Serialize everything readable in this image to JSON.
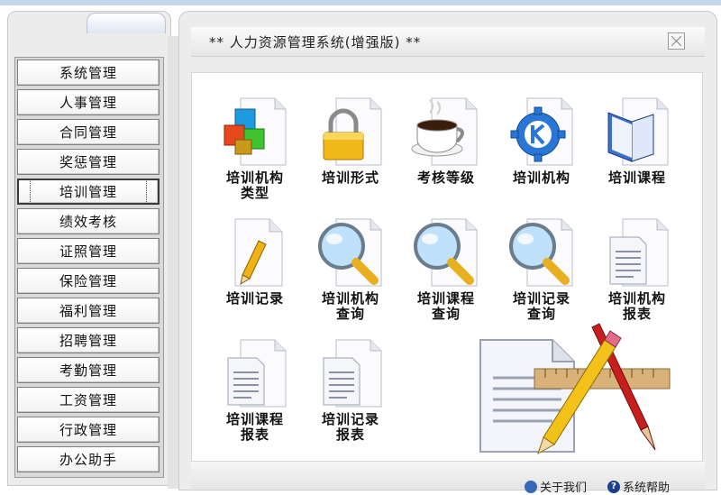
{
  "window": {
    "title": "** 人力资源管理系统(增强版) **"
  },
  "sidebar": {
    "items": [
      {
        "label": "系统管理"
      },
      {
        "label": "人事管理"
      },
      {
        "label": "合同管理"
      },
      {
        "label": "奖惩管理"
      },
      {
        "label": "培训管理",
        "active": true
      },
      {
        "label": "绩效考核"
      },
      {
        "label": "证照管理"
      },
      {
        "label": "保险管理"
      },
      {
        "label": "福利管理"
      },
      {
        "label": "招聘管理"
      },
      {
        "label": "考勤管理"
      },
      {
        "label": "工资管理"
      },
      {
        "label": "行政管理"
      },
      {
        "label": "办公助手"
      }
    ]
  },
  "modules": [
    {
      "line1": "培训机构",
      "line2": "类型",
      "icon": "colored-cubes-icon"
    },
    {
      "line1": "培训形式",
      "line2": "",
      "icon": "padlock-icon"
    },
    {
      "line1": "考核等级",
      "line2": "",
      "icon": "coffee-cup-icon"
    },
    {
      "line1": "培训机构",
      "line2": "",
      "icon": "gear-k-icon"
    },
    {
      "line1": "培训课程",
      "line2": "",
      "icon": "open-book-icon"
    },
    {
      "line1": "培训记录",
      "line2": "",
      "icon": "document-pencil-icon"
    },
    {
      "line1": "培训机构",
      "line2": "查询",
      "icon": "magnifier-icon"
    },
    {
      "line1": "培训课程",
      "line2": "查询",
      "icon": "magnifier-icon"
    },
    {
      "line1": "培训记录",
      "line2": "查询",
      "icon": "magnifier-icon"
    },
    {
      "line1": "培训机构",
      "line2": "报表",
      "icon": "report-document-icon"
    },
    {
      "line1": "培训课程",
      "line2": "报表",
      "icon": "report-document-icon"
    },
    {
      "line1": "培训记录",
      "line2": "报表",
      "icon": "report-document-icon"
    }
  ],
  "footer": {
    "about_label": "关于我们",
    "help_label": "系统帮助"
  },
  "colors": {
    "accent": "#3a66b8",
    "panel": "#ececec",
    "topstrip": "#c7d6ea"
  }
}
